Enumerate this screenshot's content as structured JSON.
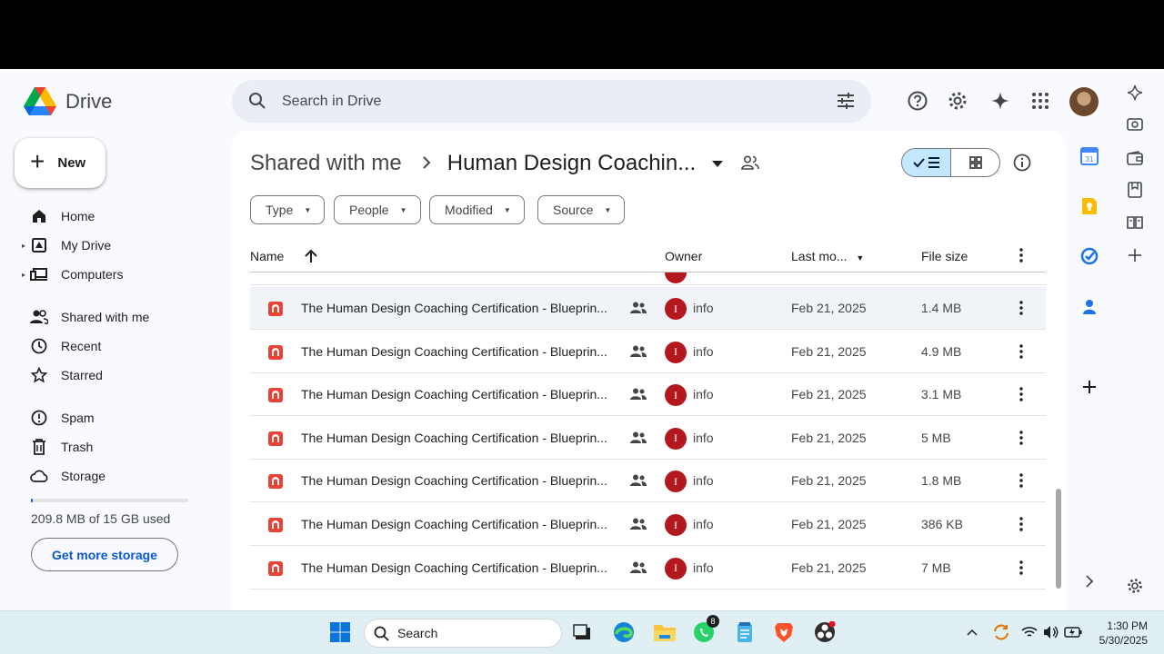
{
  "app": {
    "name": "Drive",
    "search_placeholder": "Search in Drive"
  },
  "sidebar": {
    "new_label": "New",
    "items": [
      {
        "label": "Home",
        "icon": "home-icon"
      },
      {
        "label": "My Drive",
        "icon": "my-drive-icon"
      },
      {
        "label": "Computers",
        "icon": "computers-icon"
      },
      {
        "label": "Shared with me",
        "icon": "shared-with-me-icon"
      },
      {
        "label": "Recent",
        "icon": "clock-icon"
      },
      {
        "label": "Starred",
        "icon": "star-icon"
      },
      {
        "label": "Spam",
        "icon": "spam-icon"
      },
      {
        "label": "Trash",
        "icon": "trash-icon"
      },
      {
        "label": "Storage",
        "icon": "cloud-icon"
      }
    ],
    "storage_used_fraction": 0.014,
    "storage_text": "209.8 MB of 15 GB used",
    "get_storage_label": "Get more storage"
  },
  "breadcrumb": {
    "parent": "Shared with me",
    "current": "Human Design Coachin..."
  },
  "filters": [
    "Type",
    "People",
    "Modified",
    "Source"
  ],
  "table": {
    "headers": {
      "name": "Name",
      "owner": "Owner",
      "modified": "Last mo...",
      "size": "File size"
    },
    "rows": [
      {
        "name": "The Human Design Coaching Certification - Blueprin...",
        "owner_initial": "I",
        "owner": "info",
        "modified": "Feb 21, 2025",
        "size": "1.4 MB"
      },
      {
        "name": "The Human Design Coaching Certification - Blueprin...",
        "owner_initial": "I",
        "owner": "info",
        "modified": "Feb 21, 2025",
        "size": "4.9 MB"
      },
      {
        "name": "The Human Design Coaching Certification - Blueprin...",
        "owner_initial": "I",
        "owner": "info",
        "modified": "Feb 21, 2025",
        "size": "3.1 MB"
      },
      {
        "name": "The Human Design Coaching Certification - Blueprin...",
        "owner_initial": "I",
        "owner": "info",
        "modified": "Feb 21, 2025",
        "size": "5 MB"
      },
      {
        "name": "The Human Design Coaching Certification - Blueprin...",
        "owner_initial": "I",
        "owner": "info",
        "modified": "Feb 21, 2025",
        "size": "1.8 MB"
      },
      {
        "name": "The Human Design Coaching Certification - Blueprin...",
        "owner_initial": "I",
        "owner": "info",
        "modified": "Feb 21, 2025",
        "size": "386 KB"
      },
      {
        "name": "The Human Design Coaching Certification - Blueprin...",
        "owner_initial": "I",
        "owner": "info",
        "modified": "Feb 21, 2025",
        "size": "7 MB"
      }
    ]
  },
  "taskbar": {
    "search_label": "Search",
    "whatsapp_badge": "8",
    "time": "1:30 PM",
    "date": "5/30/2025"
  },
  "colors": {
    "accent": "#0b57d0",
    "selected_view": "#c2e7ff",
    "owner_avatar": "#b3181f",
    "pdf_red": "#ea4335"
  }
}
